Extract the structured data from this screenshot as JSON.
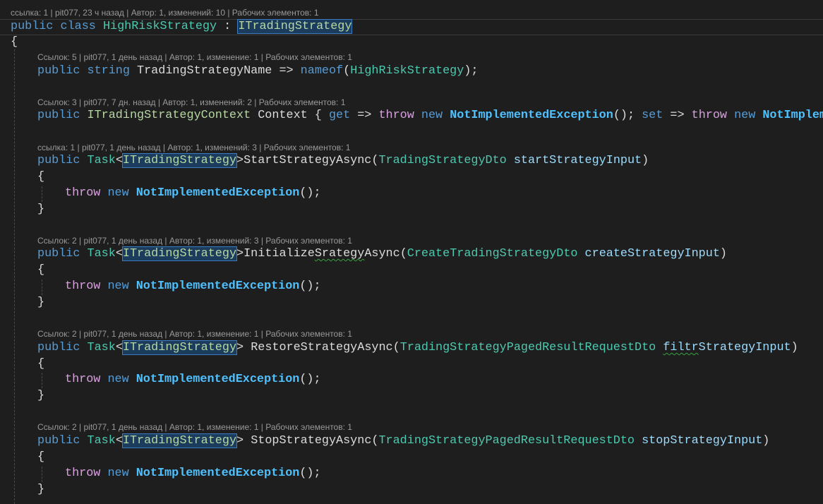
{
  "lenses": {
    "class_lens": "ссылка: 1 | pit077, 23 ч назад | Автор: 1, изменений: 10 | Рабочих элементов: 1",
    "name_lens": "Ссылок: 5 | pit077, 1 день назад | Автор: 1, изменение: 1 | Рабочих элементов: 1",
    "context_lens": "Ссылок: 3 | pit077, 7 дн. назад | Автор: 1, изменений: 2 | Рабочих элементов: 1",
    "start_lens": "ссылка: 1 | pit077, 1 день назад | Автор: 1, изменений: 3 | Рабочих элементов: 1",
    "init_lens": "Ссылок: 2 | pit077, 1 день назад | Автор: 1, изменений: 3 | Рабочих элементов: 1",
    "restore_lens": "Ссылок: 2 | pit077, 1 день назад | Автор: 1, изменение: 1 | Рабочих элементов: 1",
    "stop_lens": "Ссылок: 2 | pit077, 1 день назад | Автор: 1, изменение: 1 | Рабочих элементов: 1"
  },
  "tokens": {
    "public": "public",
    "class": "class",
    "string": "string",
    "throw": "throw",
    "new": "new",
    "get": "get",
    "set": "set",
    "nameof": "nameof",
    "task": "Task",
    "open_brace": "{",
    "close_brace": "}"
  },
  "names": {
    "class_name": "HighRiskStrategy",
    "interface": "ITradingStrategy",
    "context_interface": "ITradingStrategyContext",
    "exception": "NotImplementedException",
    "name_property": "TradingStrategyName",
    "context_property": "Context",
    "nameof_arg": "HighRiskStrategy",
    "start_method": "StartStrategyAsync",
    "start_param_type": "TradingStrategyDto",
    "start_param": "startStrategyInput",
    "init_method_a": "Initialize",
    "init_method_b": "Srategy",
    "init_method_c": "Async",
    "init_param_type": "CreateTradingStrategyDto",
    "init_param": "createStrategyInput",
    "restore_method": "RestoreStrategyAsync",
    "restore_param_type": "TradingStrategyPagedResultRequestDto",
    "restore_param_a": "filtr",
    "restore_param_b": "StrategyInput",
    "stop_method": "StopStrategyAsync",
    "stop_param_type": "TradingStrategyPagedResultRequestDto",
    "stop_param": "stopStrategyInput"
  },
  "colors": {
    "background": "#1e1e1e",
    "keyword": "#569cd6",
    "control_keyword": "#d8a0df",
    "type": "#4ec9b0",
    "interface": "#b8d7a3",
    "parameter": "#9cdcfe",
    "identifier": "#dcdcdc",
    "lens": "#999999",
    "highlight": "#1b3c5c"
  }
}
